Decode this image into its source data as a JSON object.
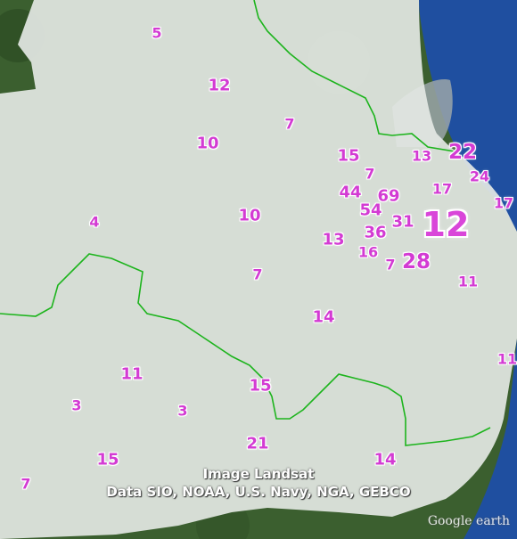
{
  "colors": {
    "land_overlay": "#e4e8e4",
    "forest": "#3b5f2f",
    "ocean": "#1f4fa0",
    "boundary": "#1db41d",
    "label": "#d33bd3"
  },
  "labels": [
    {
      "text": "5"
    },
    {
      "text": "12"
    },
    {
      "text": "7"
    },
    {
      "text": "10"
    },
    {
      "text": "15"
    },
    {
      "text": "13"
    },
    {
      "text": "22"
    },
    {
      "text": "7"
    },
    {
      "text": "24"
    },
    {
      "text": "44"
    },
    {
      "text": "69"
    },
    {
      "text": "17"
    },
    {
      "text": "17"
    },
    {
      "text": "4"
    },
    {
      "text": "10"
    },
    {
      "text": "54"
    },
    {
      "text": "31"
    },
    {
      "text": "12"
    },
    {
      "text": "13"
    },
    {
      "text": "36"
    },
    {
      "text": "16"
    },
    {
      "text": "7"
    },
    {
      "text": "28"
    },
    {
      "text": "7"
    },
    {
      "text": "11"
    },
    {
      "text": "14"
    },
    {
      "text": "11"
    },
    {
      "text": "11"
    },
    {
      "text": "15"
    },
    {
      "text": "3"
    },
    {
      "text": "3"
    },
    {
      "text": "21"
    },
    {
      "text": "15"
    },
    {
      "text": "14"
    },
    {
      "text": "7"
    }
  ],
  "attribution": {
    "line1": "Image Landsat",
    "line2": "Data SIO, NOAA, U.S. Navy, NGA, GEBCO"
  },
  "logo": "Google earth"
}
